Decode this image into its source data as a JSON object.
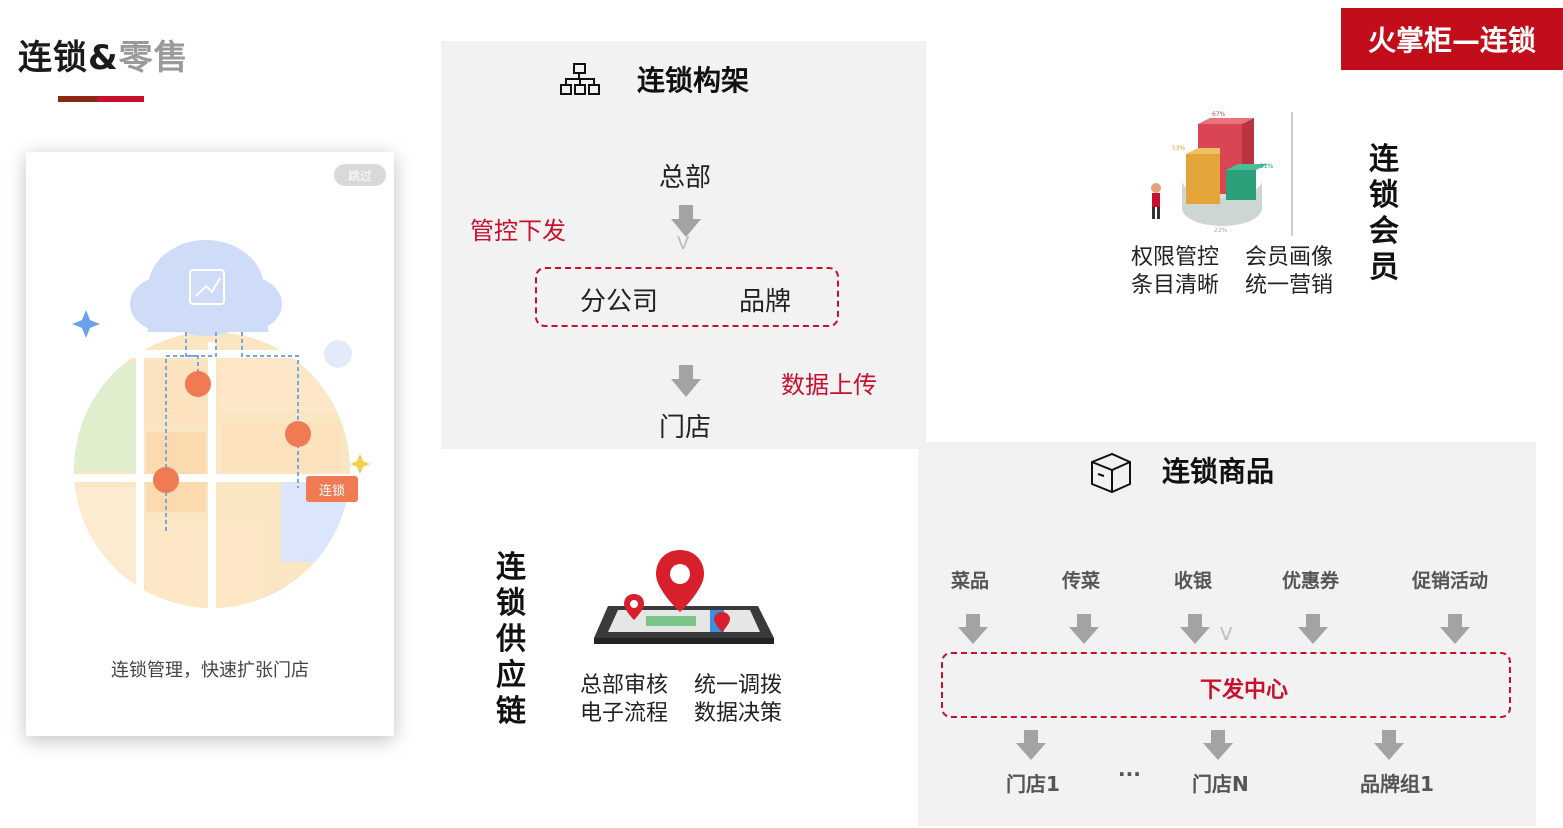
{
  "header": {
    "title_main": "连锁&",
    "title_sub": "零售",
    "brand_badge": "火掌柜—连锁"
  },
  "phone": {
    "skip_label": "跳过",
    "tag_label": "连锁",
    "caption": "连锁管理，快速扩张门店"
  },
  "architecture": {
    "title": "连锁构架",
    "hq": "总部",
    "control_note": "管控下发",
    "branch": "分公司",
    "brand": "品牌",
    "upload_note": "数据上传",
    "store": "门店",
    "v_mark": "V"
  },
  "member": {
    "title_chars": [
      "连",
      "锁",
      "会",
      "员"
    ],
    "features": [
      "权限管控",
      "会员画像",
      "条目清晰",
      "统一营销"
    ],
    "chart_labels": [
      "67%",
      "53%",
      "31%",
      "22%"
    ]
  },
  "supply": {
    "title_chars": [
      "连",
      "锁",
      "供",
      "应",
      "链"
    ],
    "features": [
      "总部审核",
      "统一调拨",
      "电子流程",
      "数据决策"
    ]
  },
  "goods": {
    "title": "连锁商品",
    "items": [
      "菜品",
      "传菜",
      "收银",
      "优惠券",
      "促销活动"
    ],
    "dispatch": "下发中心",
    "targets": [
      "门店1",
      "···",
      "门店N",
      "品牌组1"
    ],
    "v_mark": "V"
  },
  "colors": {
    "brand_red": "#c20e1b",
    "accent_red": "#c8102e",
    "panel_gray": "#f2f2f2",
    "arrow_gray": "#a3a3a3"
  }
}
